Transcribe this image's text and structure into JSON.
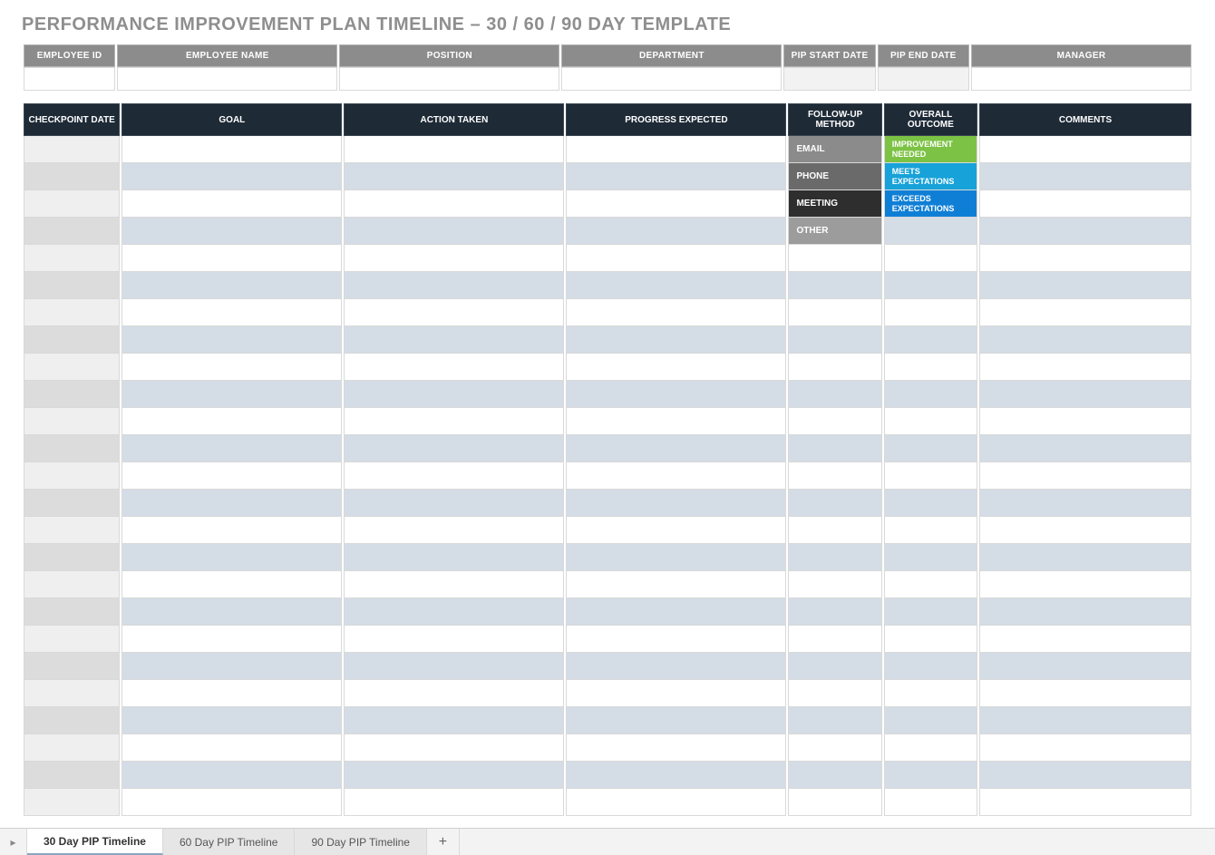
{
  "title": "PERFORMANCE IMPROVEMENT PLAN TIMELINE  –  30 / 60 / 90 DAY TEMPLATE",
  "info_headers": {
    "employee_id": "EMPLOYEE ID",
    "employee_name": "EMPLOYEE NAME",
    "position": "POSITION",
    "department": "DEPARTMENT",
    "pip_start": "PIP START DATE",
    "pip_end": "PIP END DATE",
    "manager": "MANAGER"
  },
  "info_values": {
    "employee_id": "",
    "employee_name": "",
    "position": "",
    "department": "",
    "pip_start": "",
    "pip_end": "",
    "manager": ""
  },
  "timeline_headers": {
    "checkpoint_date": "CHECKPOINT DATE",
    "goal": "GOAL",
    "action_taken": "ACTION TAKEN",
    "progress_expected": "PROGRESS EXPECTED",
    "followup_method": "FOLLOW-UP METHOD",
    "overall_outcome": "OVERALL OUTCOME",
    "comments": "COMMENTS"
  },
  "followup_options": {
    "email": "EMAIL",
    "phone": "PHONE",
    "meeting": "MEETING",
    "other": "OTHER"
  },
  "outcome_options": {
    "improvement": "IMPROVEMENT NEEDED",
    "meets": "MEETS EXPECTATIONS",
    "exceeds": "EXCEEDS EXPECTATIONS"
  },
  "row_count": 25,
  "tabs": {
    "t1": "30 Day PIP Timeline",
    "t2": "60 Day PIP Timeline",
    "t3": "90 Day PIP Timeline"
  }
}
